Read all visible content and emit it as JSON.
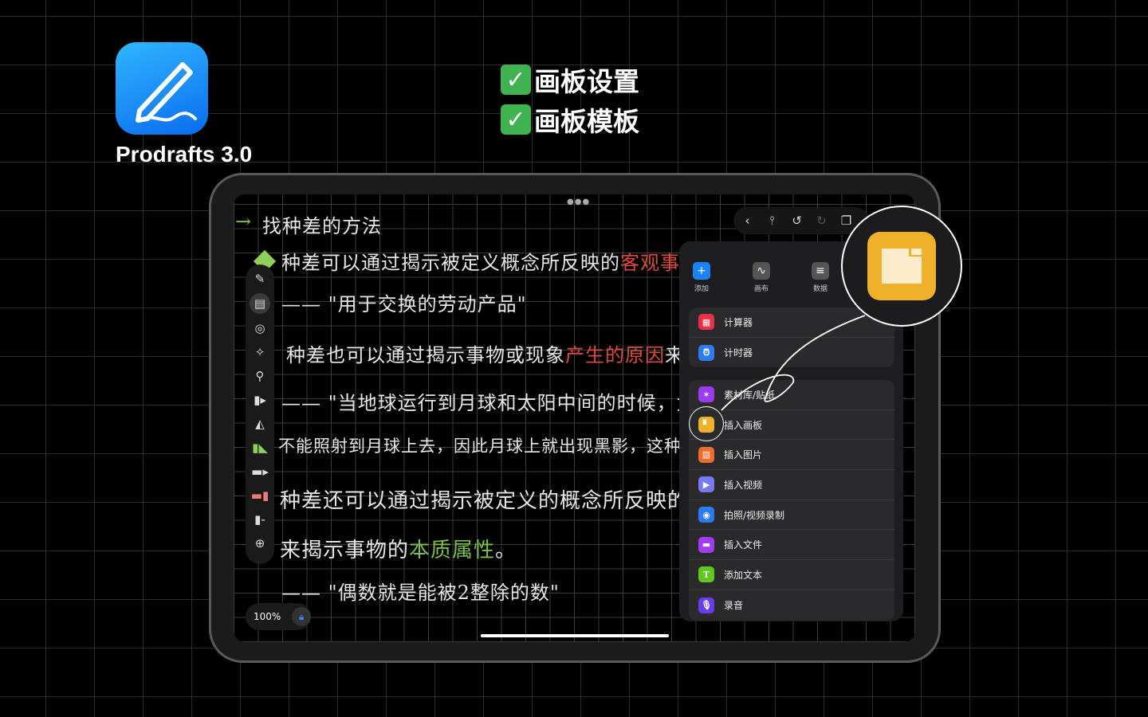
{
  "app": {
    "name": "Prodrafts 3.0",
    "icon": "pencil-icon"
  },
  "headlines": [
    "画板设置",
    "画板模板"
  ],
  "note": {
    "title": "找种差的方法",
    "lines": [
      {
        "text": "种差可以通过揭示被定义概念所反映的",
        "highlight": "客观事物"
      },
      {
        "text": "—— \"用于交换的劳动产品\""
      },
      {
        "text": "种差也可以通过揭示事物或现象",
        "highlight": "产生的原因",
        "after": "来揭示"
      },
      {
        "text": "—— \"当地球运行到月球和太阳中间的时候，太阳的"
      },
      {
        "text": "不能照射到月球上去，因此月球上就出现黑影，这种现"
      },
      {
        "text": "种差还可以通过揭示被定义的概念所反映的"
      },
      {
        "text": "来揭示事物的",
        "highlight": "本质属性",
        "after": "。"
      },
      {
        "text": "—— \"偶数就是能被2整除的数\""
      }
    ]
  },
  "zoom": "100%",
  "panel": {
    "top": [
      {
        "label": "添加",
        "icon": "plus-icon"
      },
      {
        "label": "画布",
        "icon": "wave-icon"
      },
      {
        "label": "数据",
        "icon": "lines-icon"
      }
    ],
    "group1": [
      {
        "label": "计算器",
        "icon": "calculator-icon",
        "color": "#e8304a"
      },
      {
        "label": "计时器",
        "icon": "alarm-icon",
        "color": "#2a7cf0"
      }
    ],
    "group2": [
      {
        "label": "素材库/贴纸",
        "icon": "sticker-icon",
        "color": "#9b3cf0"
      },
      {
        "label": "插入画板",
        "icon": "board-icon",
        "color": "#f0b12a"
      },
      {
        "label": "插入图片",
        "icon": "image-icon",
        "color": "#f06a2a"
      },
      {
        "label": "插入视频",
        "icon": "video-icon",
        "color": "#7a7af0"
      },
      {
        "label": "拍照/视频录制",
        "icon": "camera-icon",
        "color": "#2a7cf0"
      },
      {
        "label": "插入文件",
        "icon": "folder-icon",
        "color": "#a33cf0"
      },
      {
        "label": "添加文本",
        "icon": "text-icon",
        "color": "#5ec81e"
      },
      {
        "label": "录音",
        "icon": "mic-icon",
        "color": "#6a3cf0"
      }
    ]
  }
}
